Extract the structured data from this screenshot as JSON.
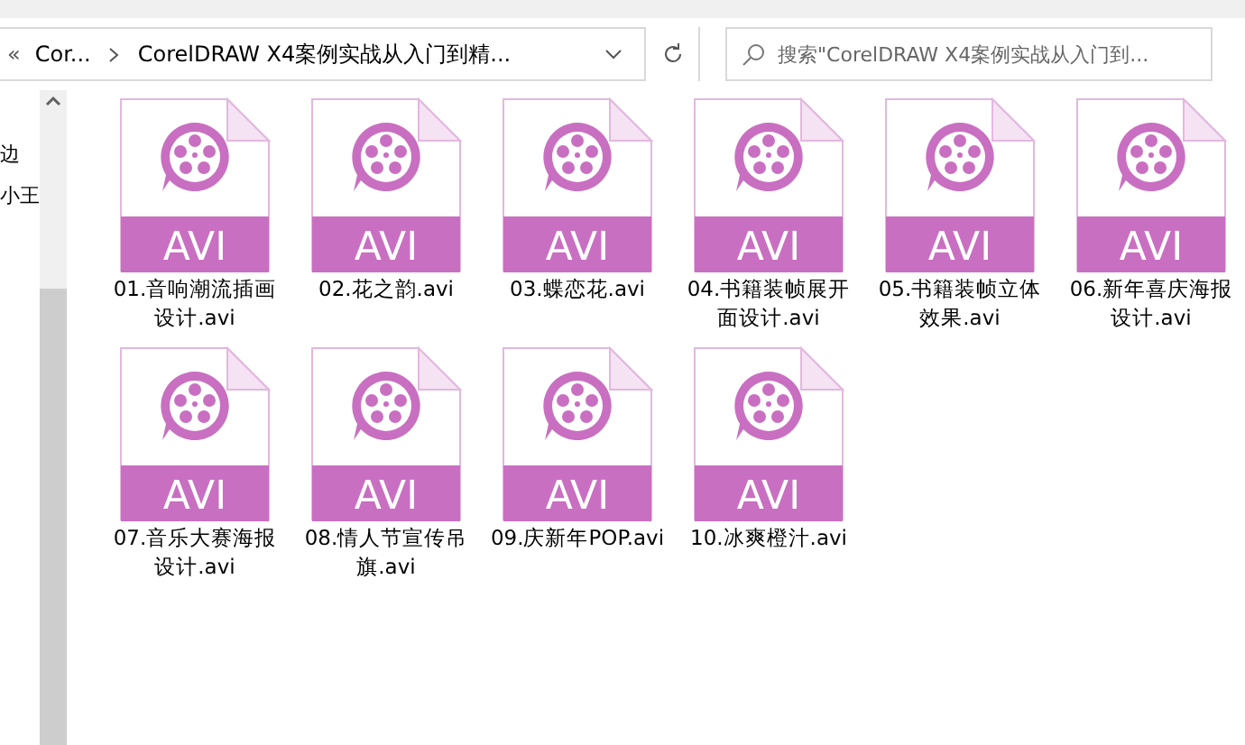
{
  "address_bar": {
    "overflow": "«",
    "crumbs": [
      "Cor...",
      "CorelDRAW X4案例实战从入门到精..."
    ]
  },
  "search": {
    "placeholder": "搜索\"CorelDRAW X4案例实战从入门到..."
  },
  "nav_pane": {
    "items": [
      "边",
      "小王"
    ]
  },
  "files": [
    {
      "name": "01.音响潮流插画设计.avi",
      "badge": "AVI"
    },
    {
      "name": "02.花之韵.avi",
      "badge": "AVI"
    },
    {
      "name": "03.蝶恋花.avi",
      "badge": "AVI"
    },
    {
      "name": "04.书籍装帧展开面设计.avi",
      "badge": "AVI"
    },
    {
      "name": "05.书籍装帧立体效果.avi",
      "badge": "AVI"
    },
    {
      "name": "06.新年喜庆海报设计.avi",
      "badge": "AVI"
    },
    {
      "name": "07.音乐大赛海报设计.avi",
      "badge": "AVI"
    },
    {
      "name": "08.情人节宣传吊旗.avi",
      "badge": "AVI"
    },
    {
      "name": "09.庆新年POP.avi",
      "badge": "AVI"
    },
    {
      "name": "10.冰爽橙汁.avi",
      "badge": "AVI"
    }
  ]
}
